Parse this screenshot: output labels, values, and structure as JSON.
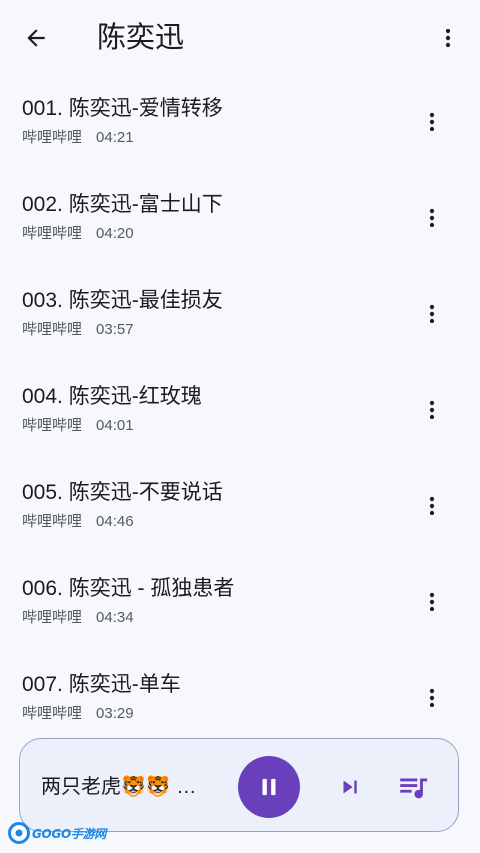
{
  "header": {
    "title": "陈奕迅",
    "back_icon": "arrow-left-icon",
    "menu_icon": "more-vert-icon"
  },
  "songs": [
    {
      "title": "001. 陈奕迅-爱情转移",
      "source": "哔哩哔哩",
      "duration": "04:21"
    },
    {
      "title": "002. 陈奕迅-富士山下",
      "source": "哔哩哔哩",
      "duration": "04:20"
    },
    {
      "title": "003. 陈奕迅-最佳损友",
      "source": "哔哩哔哩",
      "duration": "03:57"
    },
    {
      "title": "004. 陈奕迅-红玫瑰",
      "source": "哔哩哔哩",
      "duration": "04:01"
    },
    {
      "title": "005. 陈奕迅-不要说话",
      "source": "哔哩哔哩",
      "duration": "04:46"
    },
    {
      "title": "006. 陈奕迅 - 孤独患者",
      "source": "哔哩哔哩",
      "duration": "04:34"
    },
    {
      "title": "007. 陈奕迅-单车",
      "source": "哔哩哔哩",
      "duration": "03:29"
    }
  ],
  "player": {
    "now_playing": "两只老虎🐯🐯 …",
    "state_icon": "pause-icon",
    "next_icon": "skip-next-icon",
    "queue_icon": "queue-music-icon"
  },
  "watermark": {
    "text": "GOGO手游网"
  },
  "colors": {
    "background": "#f6f8fc",
    "accent": "#6a3fbb",
    "player_background": "#ecf0fb",
    "player_border": "#9aa3c4",
    "secondary_text": "#555a60"
  }
}
